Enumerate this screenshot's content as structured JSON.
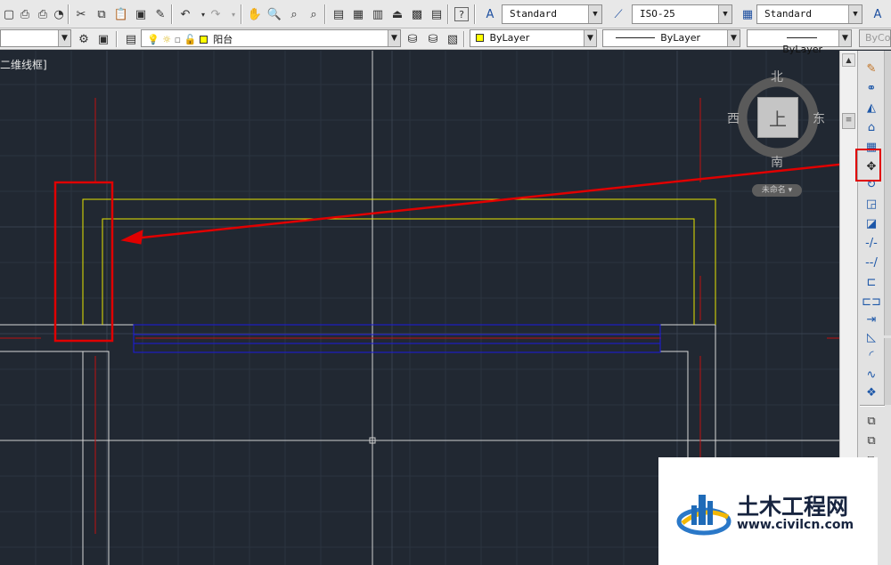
{
  "toolbar_styles": {
    "text_style": "Standard",
    "dim_style": "ISO-25",
    "table_style": "Standard"
  },
  "layers": {
    "current_layer": "阳台"
  },
  "properties": {
    "color": "ByLayer",
    "linetype": "ByLayer",
    "lineweight": "ByLayer",
    "plot_style": "ByCo"
  },
  "viewport": {
    "label": "二维线框]"
  },
  "viewcube": {
    "north": "北",
    "south": "南",
    "east": "东",
    "west": "西",
    "top": "上",
    "ucs": "未命名"
  },
  "watermark": {
    "title": "土木工程网",
    "url": "www.civilcn.com"
  },
  "colors": {
    "canvas": "#212832",
    "grid": "#2c3440",
    "yellow": "#e6e600",
    "blue": "#1a1ae0",
    "red": "#d01010",
    "white": "#d8d8d8",
    "annotation": "#e00000"
  }
}
